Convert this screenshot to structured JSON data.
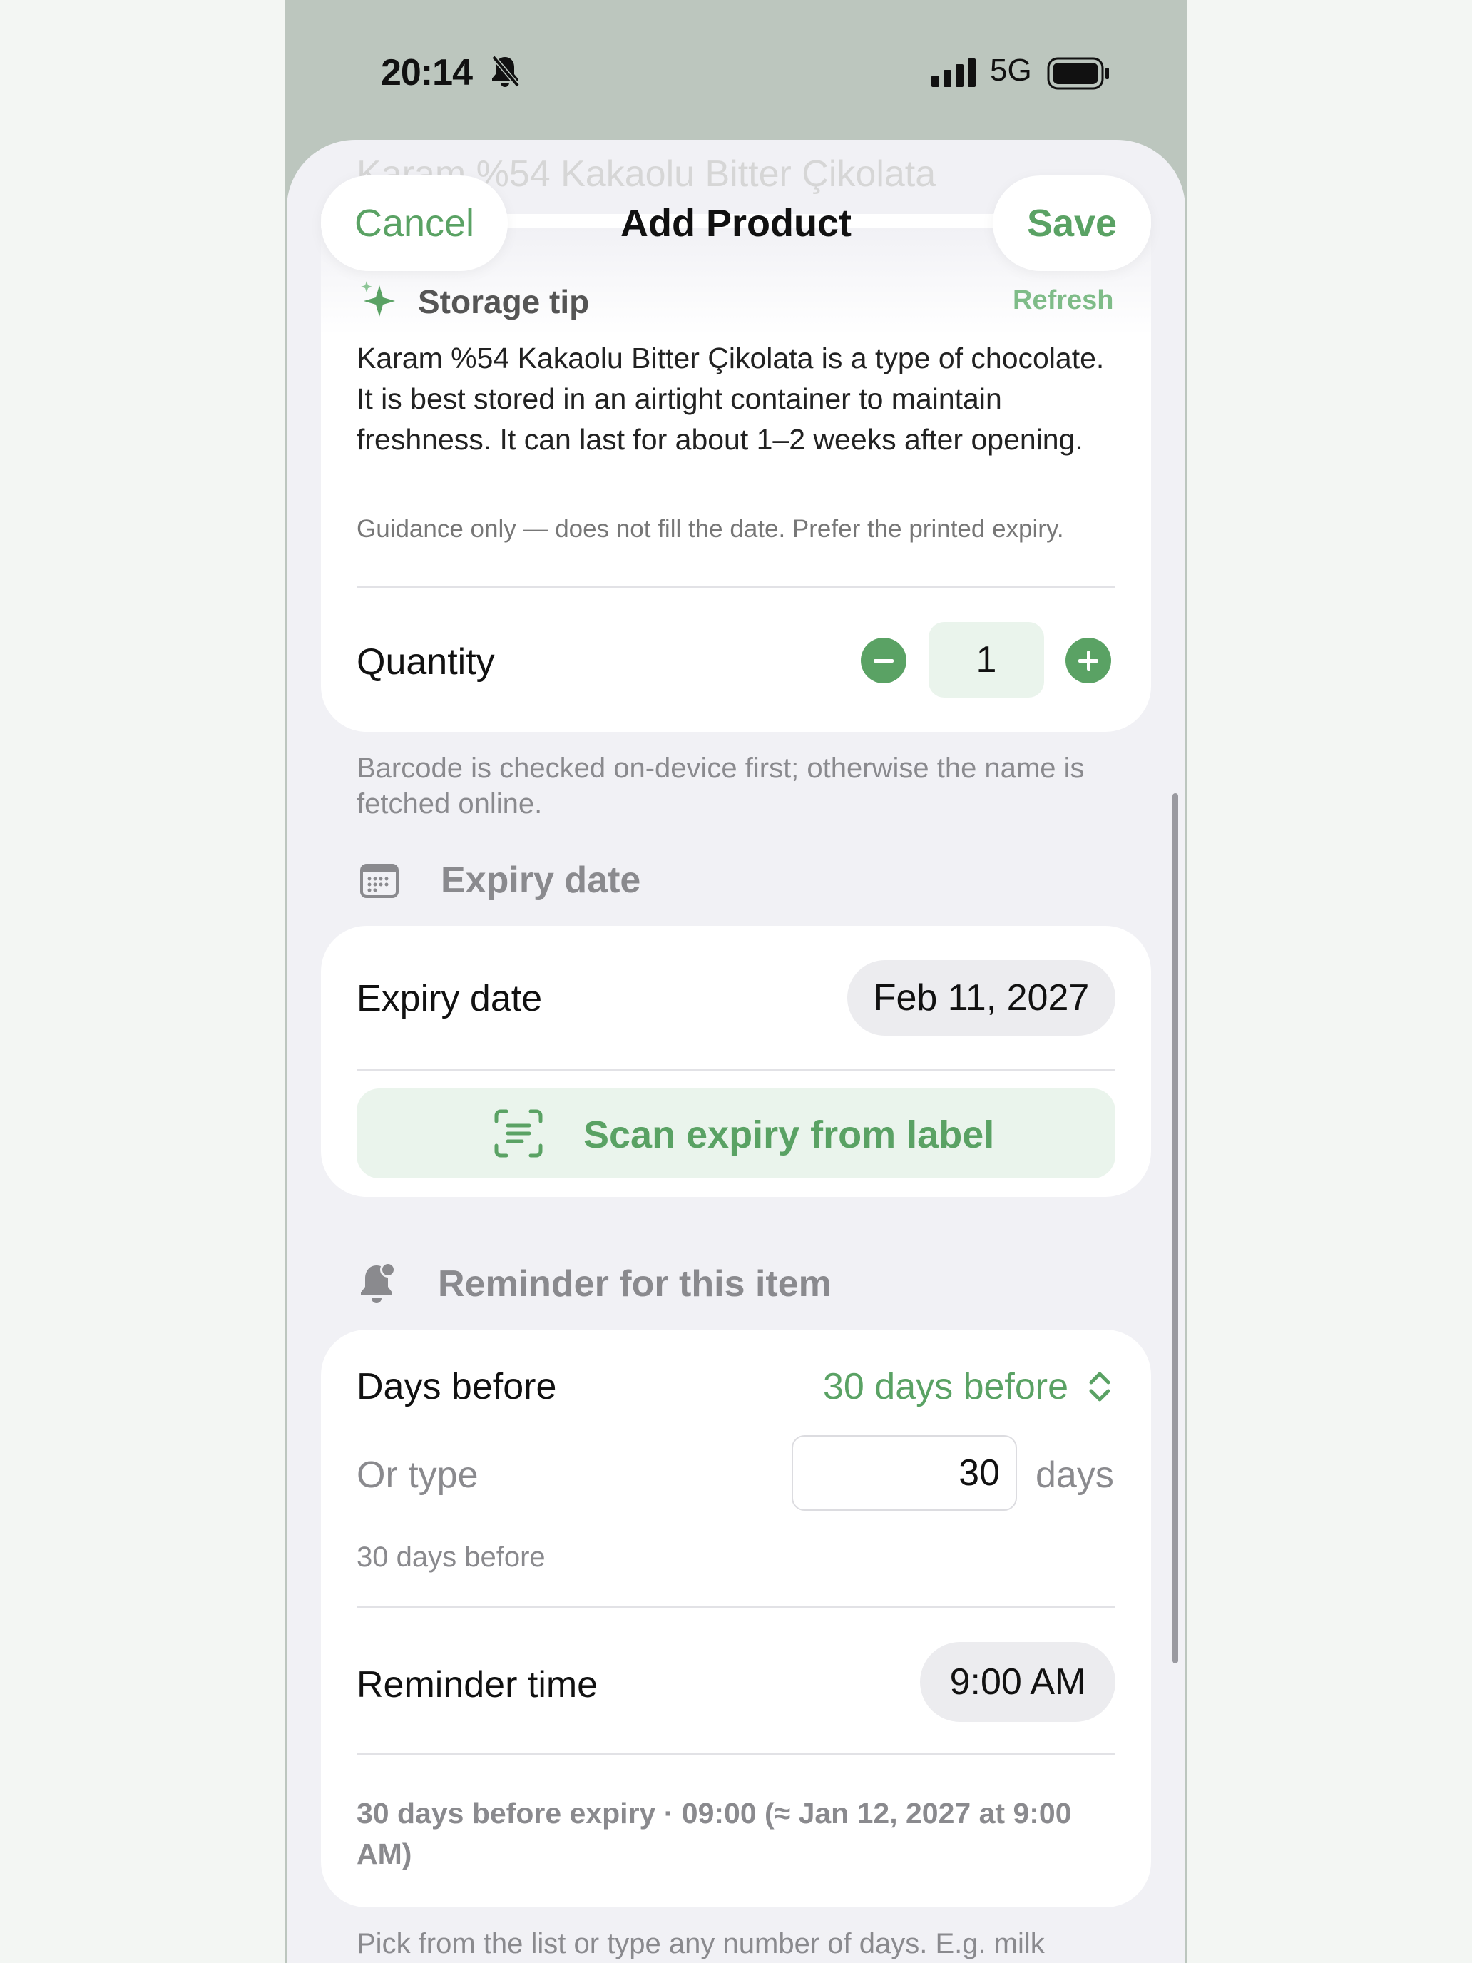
{
  "status_bar": {
    "time": "20:14",
    "network": "5G"
  },
  "nav": {
    "ghost_title": "Karam %54 Kakaolu Bitter Çikolata",
    "cancel": "Cancel",
    "title": "Add Product",
    "save": "Save"
  },
  "storage_tip": {
    "title": "Storage tip",
    "refresh": "Refresh",
    "body": "Karam %54 Kakaolu Bitter Çikolata is a type of chocolate. It is best stored in an airtight container to maintain freshness. It can last for about 1–2 weeks after opening.",
    "note": "Guidance only — does not fill the date. Prefer the printed expiry."
  },
  "quantity": {
    "label": "Quantity",
    "value": "1"
  },
  "barcode_footnote": "Barcode is checked on-device first; otherwise the name is fetched online.",
  "expiry": {
    "section_title": "Expiry date",
    "label": "Expiry date",
    "value": "Feb 11, 2027",
    "scan_button": "Scan expiry from label"
  },
  "reminder": {
    "section_title": "Reminder for this item",
    "days_before_label": "Days before",
    "days_before_value": "30 days before",
    "or_type_label": "Or type",
    "or_type_value": "30",
    "unit": "days",
    "days_caption": "30 days before",
    "time_label": "Reminder time",
    "time_value": "9:00 AM",
    "summary": "30 days before expiry · 09:00 (≈ Jan 12, 2027 at 9:00 AM)"
  },
  "bottom_footnote": "Pick from the list or type any number of days. E.g. milk",
  "colors": {
    "accent": "#5aa264",
    "accent_light": "#eaf4ec",
    "sheet_bg": "#f1f1f5"
  }
}
